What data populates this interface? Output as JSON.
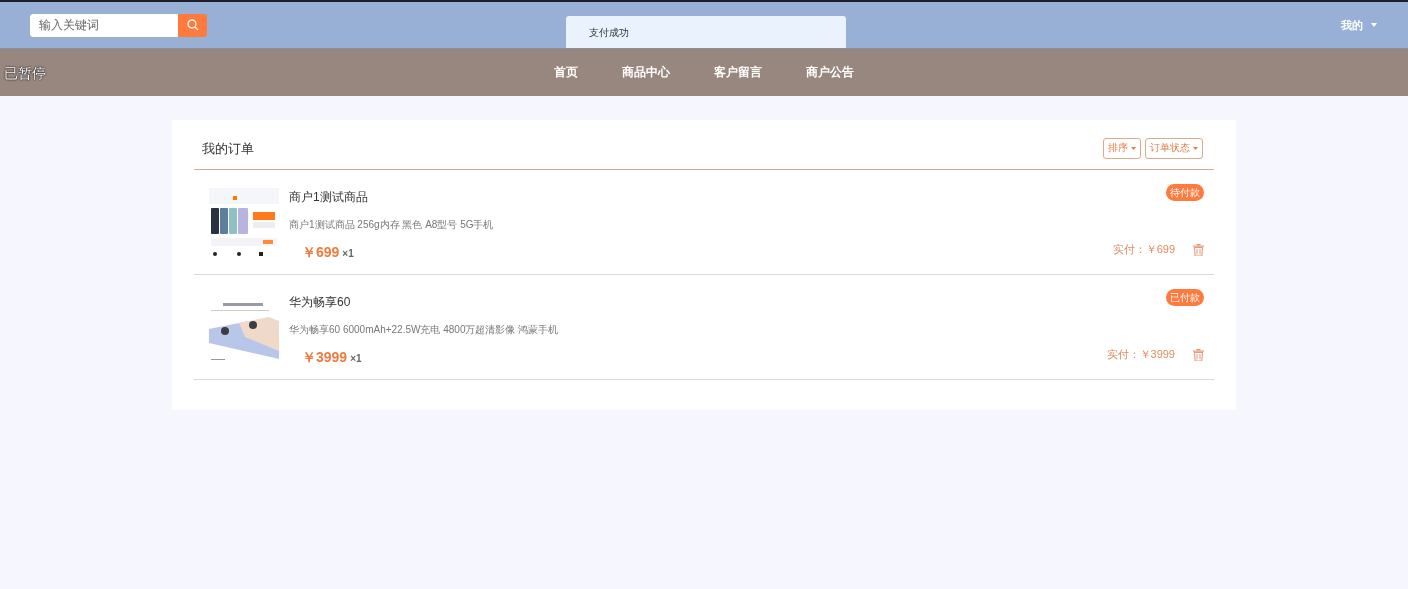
{
  "header": {
    "search": {
      "placeholder": "输入关键词"
    },
    "user_menu": {
      "label": "我的"
    }
  },
  "toast": {
    "message": "支付成功"
  },
  "nav": {
    "status": "已暂停",
    "items": [
      {
        "label": "首页"
      },
      {
        "label": "商品中心"
      },
      {
        "label": "客户留言"
      },
      {
        "label": "商户公告"
      }
    ]
  },
  "orders": {
    "title": "我的订单",
    "filters": [
      {
        "label": "排序"
      },
      {
        "label": "订单状态"
      }
    ],
    "items": [
      {
        "name": "商户1测试商品",
        "description": "商户1测试商品 256g内存 黑色 A8型号 5G手机",
        "price": "￥699",
        "quantity": "×1",
        "status": "待付款",
        "paid": "实付：￥699"
      },
      {
        "name": "华为畅享60",
        "description": "华为畅享60 6000mAh+22.5W充电 4800万超清影像 鸿蒙手机",
        "price": "￥3999",
        "quantity": "×1",
        "status": "已付款",
        "paid": "实付：￥3999"
      }
    ]
  }
}
